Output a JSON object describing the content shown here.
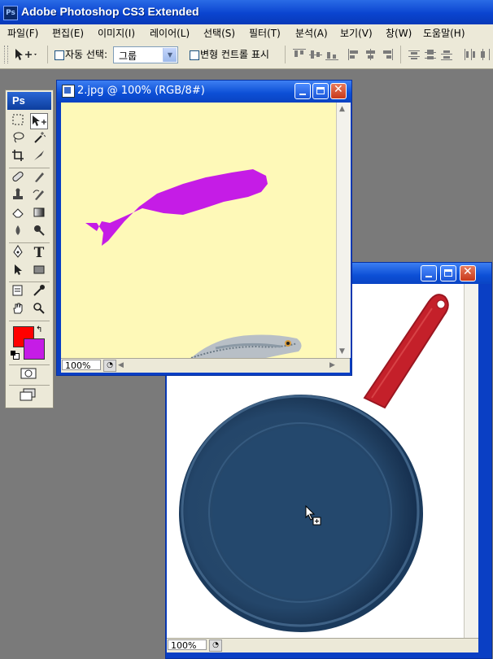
{
  "app": {
    "title": "Adobe Photoshop CS3 Extended",
    "icon_text": "Ps"
  },
  "menu": [
    {
      "label": "파일(F)"
    },
    {
      "label": "편집(E)"
    },
    {
      "label": "이미지(I)"
    },
    {
      "label": "레이어(L)"
    },
    {
      "label": "선택(S)"
    },
    {
      "label": "필터(T)"
    },
    {
      "label": "분석(A)"
    },
    {
      "label": "보기(V)"
    },
    {
      "label": "창(W)"
    },
    {
      "label": "도움말(H)"
    }
  ],
  "options": {
    "auto_select_label": "자동 선택:",
    "auto_select_value": "그룹",
    "transform_controls_label": "변형 컨트롤 표시"
  },
  "toolbox": {
    "logo": "Ps"
  },
  "doc1": {
    "title": "2.jpg @ 100% (RGB/8#)",
    "zoom": "100%",
    "background_color": "#fef9b8",
    "shape_color": "#c51ce6"
  },
  "doc2": {
    "zoom": "100%",
    "background_color": "#ffffff"
  },
  "colors": {
    "foreground": "#ff0000",
    "background": "#c51ce6"
  }
}
